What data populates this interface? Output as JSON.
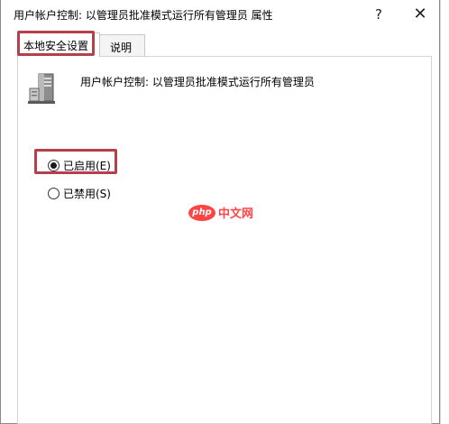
{
  "window": {
    "title": "用户帐户控制: 以管理员批准模式运行所有管理员 属性",
    "help_label": "?",
    "close_label": "✕"
  },
  "tabs": [
    {
      "label": "本地安全设置",
      "active": true
    },
    {
      "label": "说明",
      "active": false
    }
  ],
  "policy": {
    "icon": "server-icon",
    "name": "用户帐户控制: 以管理员批准模式运行所有管理员"
  },
  "options": [
    {
      "label": "已启用(E)",
      "checked": true
    },
    {
      "label": "已禁用(S)",
      "checked": false
    }
  ],
  "watermark": {
    "logo_text": "php",
    "text": "中文网"
  },
  "colors": {
    "highlight": "#b5404a",
    "watermark": "#ff3b3b"
  }
}
